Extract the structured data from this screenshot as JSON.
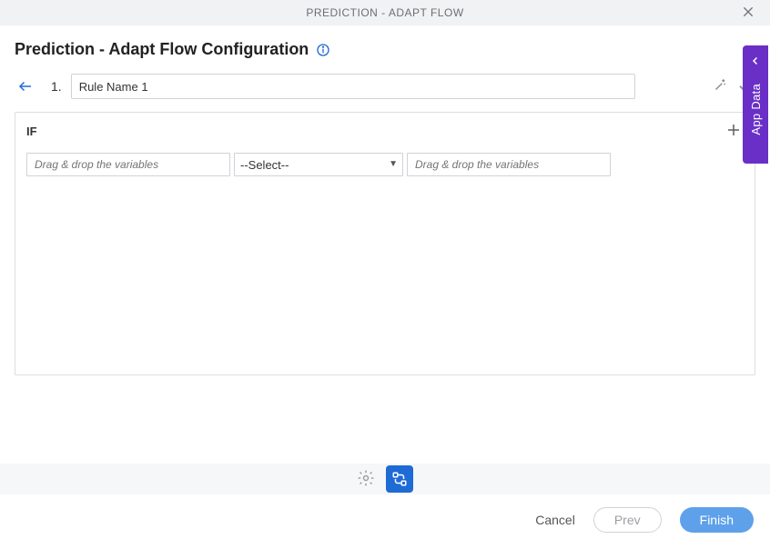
{
  "header": {
    "title": "PREDICTION - ADAPT FLOW"
  },
  "page": {
    "title": "Prediction - Adapt Flow Configuration"
  },
  "rule": {
    "number": "1.",
    "name": "Rule Name 1"
  },
  "condition": {
    "if_label": "IF",
    "var_placeholder": "Drag & drop the variables",
    "operator_selected": "--Select--"
  },
  "side_tab": {
    "label": "App Data"
  },
  "footer": {
    "cancel": "Cancel",
    "prev": "Prev",
    "finish": "Finish"
  }
}
